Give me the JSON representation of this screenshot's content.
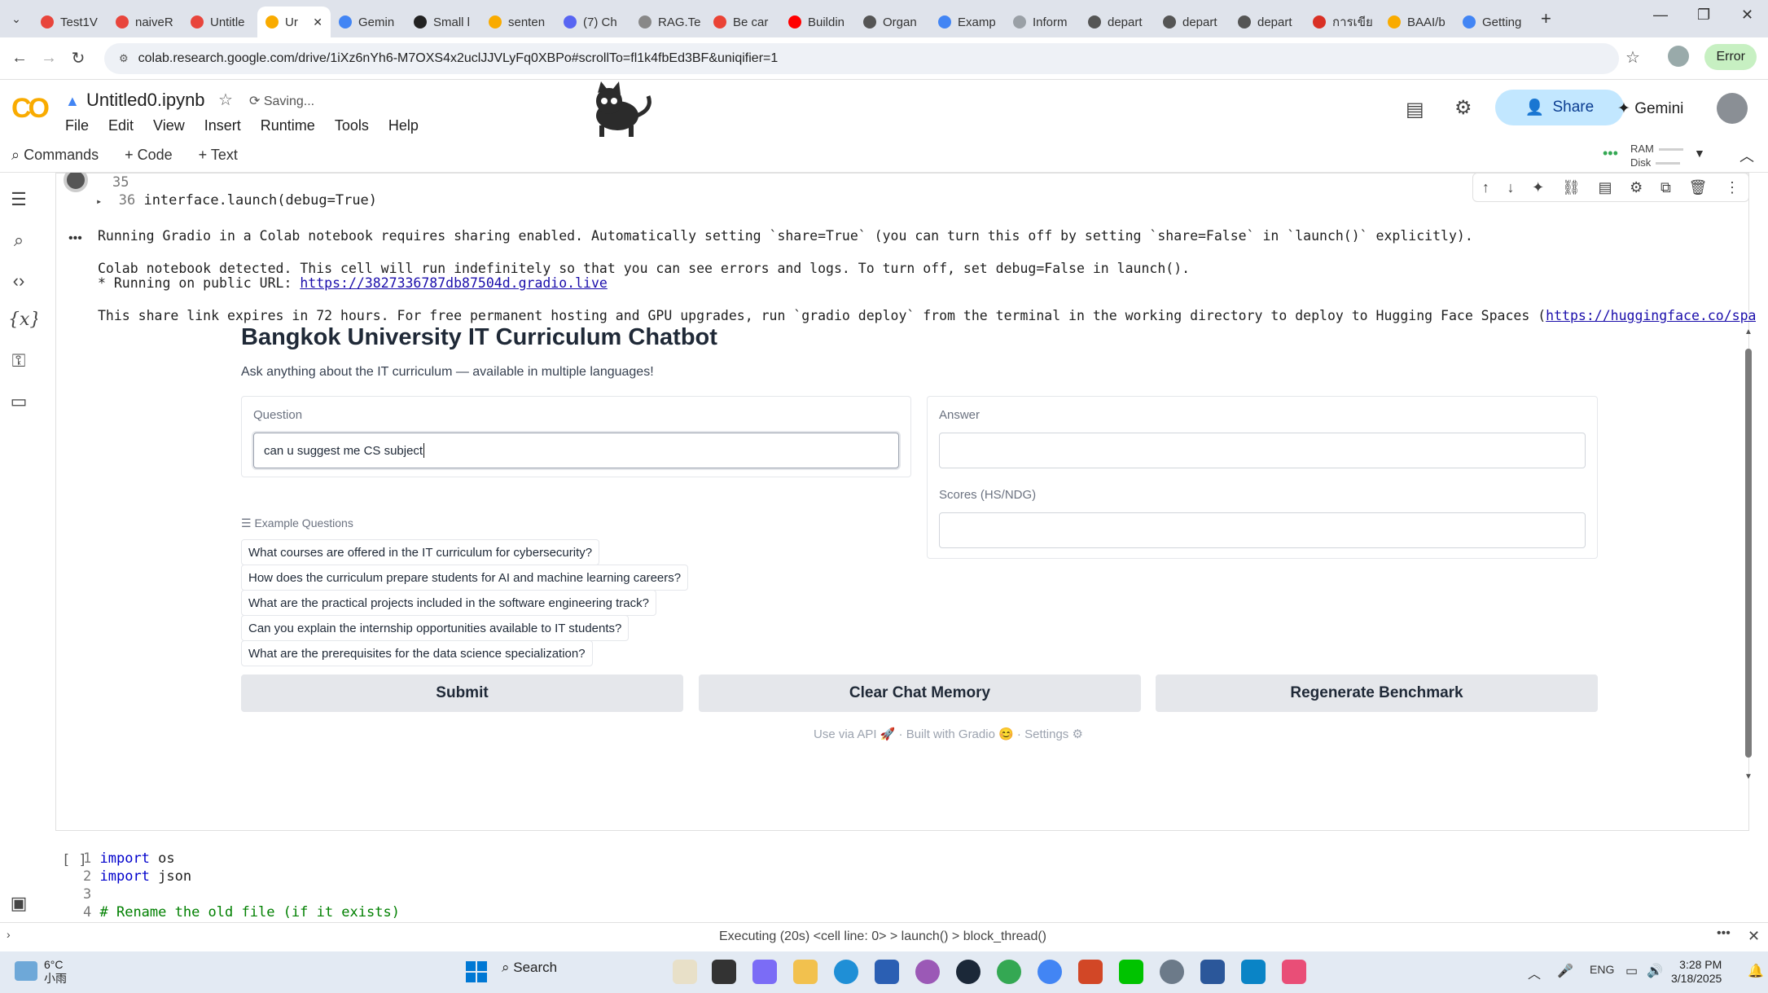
{
  "browser": {
    "tabs": [
      {
        "label": "Test1V",
        "color": "#e8453c"
      },
      {
        "label": "naiveR",
        "color": "#e8453c"
      },
      {
        "label": "Untitle",
        "color": "#e8453c"
      },
      {
        "label": "Ur",
        "color": "#f9ab00",
        "active": true
      },
      {
        "label": "Gemin",
        "color": "#4285f4"
      },
      {
        "label": "Small l",
        "color": "#222222"
      },
      {
        "label": "senten",
        "color": "#f9ab00"
      },
      {
        "label": "(7) Ch",
        "color": "#5865f2"
      },
      {
        "label": "RAG.Te",
        "color": "#888888"
      },
      {
        "label": "Be car",
        "color": "#ea4335"
      },
      {
        "label": "Buildin",
        "color": "#ff0000"
      },
      {
        "label": "Organ",
        "color": "#555555"
      },
      {
        "label": "Examp",
        "color": "#4285f4"
      },
      {
        "label": "Inform",
        "color": "#9aa0a6"
      },
      {
        "label": "depart",
        "color": "#555555"
      },
      {
        "label": "depart",
        "color": "#555555"
      },
      {
        "label": "depart",
        "color": "#555555"
      },
      {
        "label": "การเขีย",
        "color": "#d93025"
      },
      {
        "label": "BAAI/b",
        "color": "#f9ab00"
      },
      {
        "label": "Getting",
        "color": "#4285f4"
      }
    ],
    "url": "colab.research.google.com/drive/1iXz6nYh6-M7OXS4x2uclJJVLyFq0XBPo#scrollTo=fl1k4fbEd3BF&uniqifier=1",
    "error_label": "Error"
  },
  "colab": {
    "logo": "CO",
    "notebook_title": "Untitled0.ipynb",
    "saving": "Saving...",
    "menus": [
      "File",
      "Edit",
      "View",
      "Insert",
      "Runtime",
      "Tools",
      "Help"
    ],
    "share": "Share",
    "gemini": "Gemini",
    "toolbar": {
      "commands": "Commands",
      "code": "+ Code",
      "text": "+ Text",
      "ram": "RAM",
      "disk": "Disk"
    }
  },
  "cell": {
    "lines": [
      {
        "num": "35",
        "code": ""
      },
      {
        "num": "36",
        "code": "interface.launch(debug=True)"
      }
    ],
    "output": {
      "line1": "Running Gradio in a Colab notebook requires sharing enabled. Automatically setting `share=True` (you can turn this off by setting `share=False` in `launch()` explicitly).",
      "line2": "Colab notebook detected. This cell will run indefinitely so that you can see errors and logs. To turn off, set debug=False in launch().",
      "line3_prefix": "* Running on public URL: ",
      "line3_link": "https://3827336787db87504d.gradio.live",
      "line4_prefix": "This share link expires in 72 hours. For free permanent hosting and GPU upgrades, run `gradio deploy` from the terminal in the working directory to deploy to Hugging Face Spaces (",
      "line4_link": "https://huggingface.co/spaces",
      "line4_suffix": ")"
    }
  },
  "gradio": {
    "title": "Bangkok University IT Curriculum Chatbot",
    "subtitle": "Ask anything about the IT curriculum — available in multiple languages!",
    "question_label": "Question",
    "question_value": "can u suggest me CS subject",
    "answer_label": "Answer",
    "answer_value": "",
    "scores_label": "Scores (HS/NDG)",
    "scores_value": "",
    "examples_label": "☰ Example Questions",
    "examples": [
      "What courses are offered in the IT curriculum for cybersecurity?",
      "How does the curriculum prepare students for AI and machine learning careers?",
      "What are the practical projects included in the software engineering track?",
      "Can you explain the internship opportunities available to IT students?",
      "What are the prerequisites for the data science specialization?"
    ],
    "buttons": {
      "submit": "Submit",
      "clear": "Clear Chat Memory",
      "regen": "Regenerate Benchmark"
    },
    "footer": "Use via API 🚀  ·  Built with Gradio 😊  ·  Settings ⚙"
  },
  "next_cell": {
    "run_label": "[ ]",
    "lines": [
      {
        "num": "1",
        "kw": "import",
        "rest": " os"
      },
      {
        "num": "2",
        "kw": "import",
        "rest": " json"
      },
      {
        "num": "3",
        "kw": "",
        "rest": ""
      },
      {
        "num": "4",
        "kw": "",
        "rest": "# Rename the old file (if it exists)"
      }
    ]
  },
  "status": "Executing (20s) <cell line: 0> > launch() > block_thread()",
  "taskbar": {
    "temp": "6°C",
    "weather": "小雨",
    "search": "Search",
    "lang": "ENG",
    "time": "3:28 PM",
    "date": "3/18/2025"
  }
}
